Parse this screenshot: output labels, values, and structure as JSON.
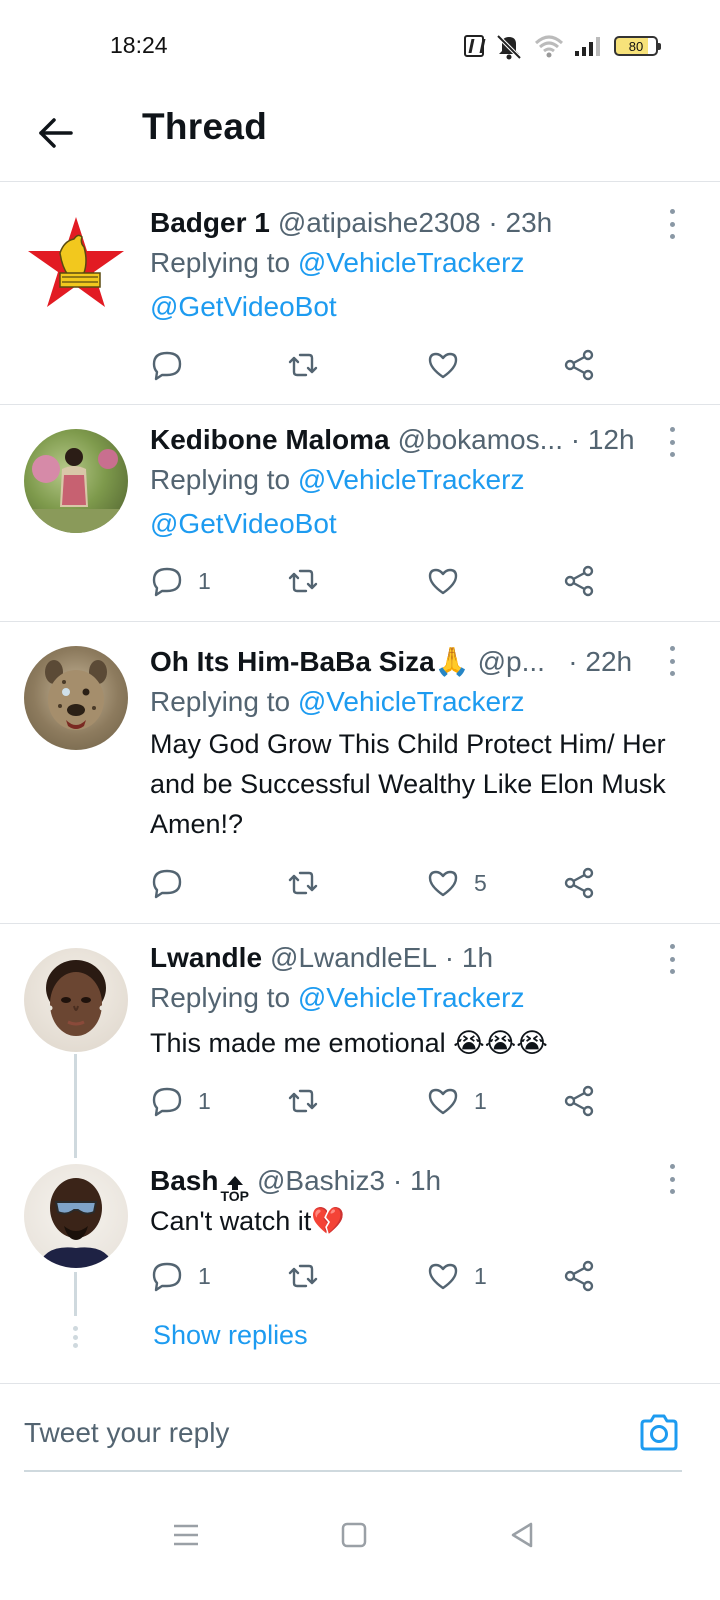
{
  "status_bar": {
    "time": "18:24",
    "battery": "80"
  },
  "header": {
    "title": "Thread"
  },
  "tweets": [
    {
      "author": "Badger 1",
      "handle": "@atipaishe2308",
      "dot": "·",
      "time": "23h",
      "replying_prefix": "Replying to",
      "replying_to": "@VehicleTrackerz",
      "body_mention": "@GetVideoBot",
      "actions": {
        "replies": "",
        "retweets": "",
        "likes": ""
      }
    },
    {
      "author": "Kedibone Maloma",
      "handle": "@bokamos...",
      "dot": "·",
      "time": "12h",
      "replying_prefix": "Replying to",
      "replying_to": "@VehicleTrackerz",
      "body_mention": "@GetVideoBot",
      "actions": {
        "replies": "1",
        "retweets": "",
        "likes": ""
      }
    },
    {
      "author": "Oh Its Him-BaBa Siza🙏",
      "handle": "@p...",
      "dot": "·",
      "time": "22h",
      "replying_prefix": "Replying to",
      "replying_to": "@VehicleTrackerz",
      "text": "May God Grow This Child Protect Him/ Her and be Successful Wealthy Like Elon Musk Amen!?",
      "actions": {
        "replies": "",
        "retweets": "",
        "likes": "5"
      }
    },
    {
      "author": "Lwandle",
      "handle": "@LwandleEL",
      "dot": "·",
      "time": "1h",
      "replying_prefix": "Replying to",
      "replying_to": "@VehicleTrackerz",
      "text": "This made me emotional 😭😭😭",
      "actions": {
        "replies": "1",
        "retweets": "",
        "likes": "1"
      }
    },
    {
      "author": "Bash",
      "author_badge": "TOP",
      "handle": "@Bashiz3",
      "dot": "·",
      "time": "1h",
      "text": "Can't watch it💔",
      "actions": {
        "replies": "1",
        "retweets": "",
        "likes": "1"
      }
    }
  ],
  "show_replies": "Show replies",
  "composer": {
    "placeholder": "Tweet your reply"
  },
  "colors": {
    "accent": "#1d9bf0",
    "secondary_text": "#536471",
    "divider": "#e1e4e8"
  },
  "icons": [
    "back-arrow-icon",
    "more-icon",
    "reply-icon",
    "retweet-icon",
    "like-icon",
    "share-icon",
    "camera-icon",
    "menu-icon",
    "home-square-icon",
    "back-triangle-icon"
  ]
}
